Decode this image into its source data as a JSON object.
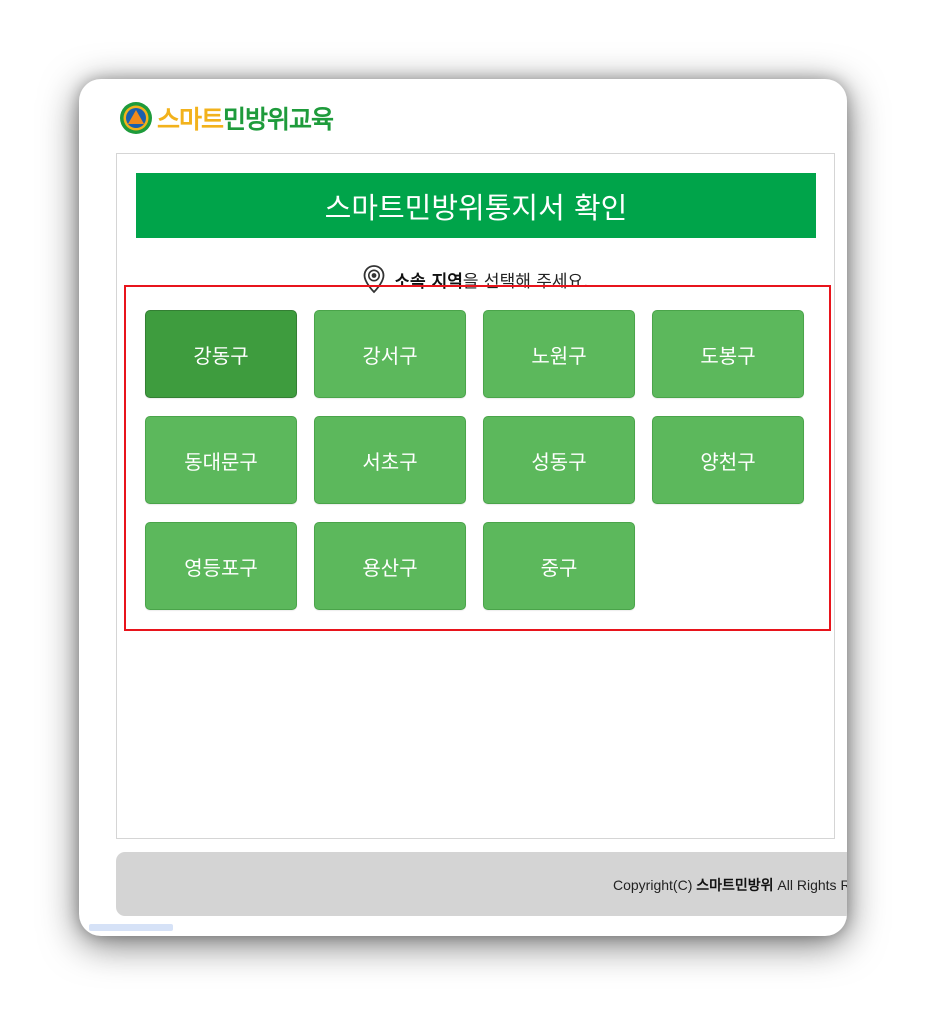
{
  "logo": {
    "text_part1": "스마트",
    "text_part2": "민방위교육",
    "colors": {
      "part1": "#f2b21c",
      "part2": "#1e9b3b"
    }
  },
  "banner": {
    "title": "스마트민방위통지서 확인",
    "color": "#00a44a"
  },
  "prompt": {
    "bold": "소속 지역",
    "rest": "을 선택해 주세요."
  },
  "districts": [
    {
      "label": "강동구",
      "active": true
    },
    {
      "label": "강서구"
    },
    {
      "label": "노원구"
    },
    {
      "label": "도봉구"
    },
    {
      "label": "동대문구"
    },
    {
      "label": "서초구"
    },
    {
      "label": "성동구"
    },
    {
      "label": "양천구"
    },
    {
      "label": "영등포구"
    },
    {
      "label": "용산구"
    },
    {
      "label": "중구"
    }
  ],
  "footer": {
    "prefix": "Copyright(C) ",
    "brand": "스마트민방위",
    "suffix": " All Rights Reserved."
  },
  "colors": {
    "button": "#5cb85c",
    "button_active": "#3e9c3e",
    "highlight": "#e8141c"
  },
  "icons": {
    "logo": "civil-defense-emblem-icon",
    "prompt": "map-pin-icon"
  }
}
